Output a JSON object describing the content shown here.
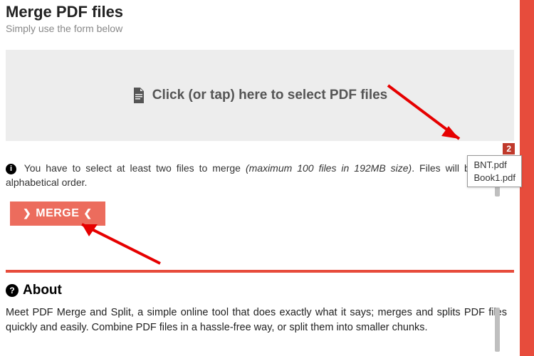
{
  "header": {
    "title": "Merge PDF files",
    "subtitle": "Simply use the form below"
  },
  "dropzone": {
    "label": "Click (or tap) here to select PDF files"
  },
  "info": {
    "part1": "You have to select at least two files to merge",
    "em": "(maximum 100 files in 192MB size)",
    "part2": ". Files will be merged",
    "part3": "alphabetical order."
  },
  "merge": {
    "label": "MERGE"
  },
  "badge": {
    "count": "2"
  },
  "files": [
    "BNT.pdf",
    "Book1.pdf"
  ],
  "about": {
    "heading": "About",
    "text": "Meet PDF Merge and Split, a simple online tool that does exactly what it says; merges and splits PDF files quickly and easily. Combine PDF files in a hassle-free way, or split them into smaller chunks."
  }
}
